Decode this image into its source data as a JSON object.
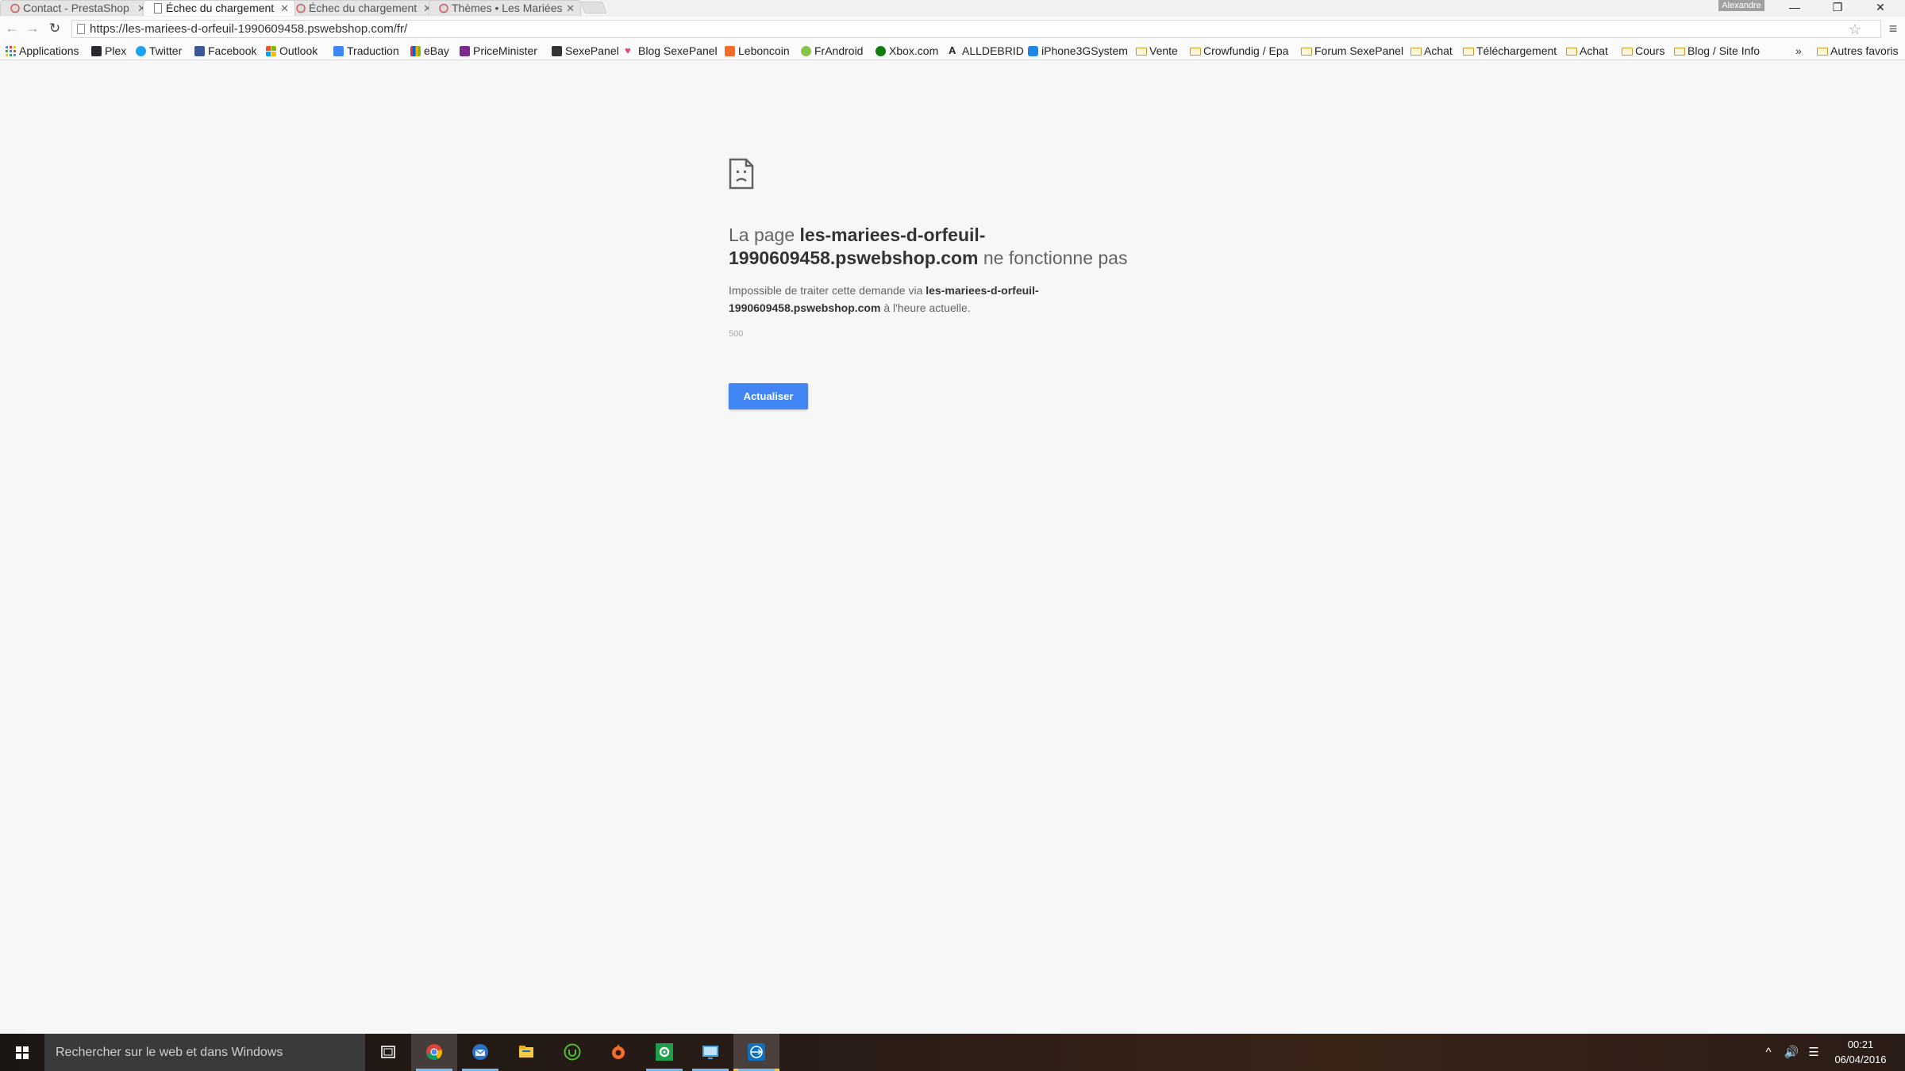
{
  "browser": {
    "tabs": [
      {
        "title": "Contact - PrestaShop"
      },
      {
        "title": "Échec du chargement"
      },
      {
        "title": "Échec du chargement"
      },
      {
        "title": "Thèmes • Les Mariées"
      }
    ],
    "profile_name": "Alexandre",
    "window_controls": {
      "minimize": "—",
      "maximize": "❐",
      "close": "✕"
    },
    "address": "https://les-mariees-d-orfeuil-1990609458.pswebshop.com/fr/",
    "nav": {
      "back": "←",
      "forward": "→",
      "reload": "↻"
    },
    "star": "☆",
    "menu": "≡"
  },
  "bookmarks": {
    "items": [
      {
        "label": "Applications",
        "icon": "apps-grid-icon",
        "color": "#4285f4"
      },
      {
        "label": "Plex",
        "icon": "plex-icon",
        "color": "#282a2d"
      },
      {
        "label": "Twitter",
        "icon": "twitter-icon",
        "color": "#1da1f2"
      },
      {
        "label": "Facebook",
        "icon": "facebook-icon",
        "color": "#3b5998"
      },
      {
        "label": "Outlook",
        "icon": "outlook-icon",
        "color": "#f25022"
      },
      {
        "label": "Traduction",
        "icon": "translate-icon",
        "color": "#4285f4"
      },
      {
        "label": "eBay",
        "icon": "ebay-icon",
        "color": "#e53238"
      },
      {
        "label": "PriceMinister",
        "icon": "priceminister-icon",
        "color": "#7b2a8c"
      },
      {
        "label": "SexePanel",
        "icon": "sexepanel-icon",
        "color": "#333333"
      },
      {
        "label": "Blog SexePanel",
        "icon": "heart-icon",
        "color": "#e0457b"
      },
      {
        "label": "Leboncoin",
        "icon": "leboncoin-icon",
        "color": "#f56b2a"
      },
      {
        "label": "FrAndroid",
        "icon": "frandroid-icon",
        "color": "#8bc34a"
      },
      {
        "label": "Xbox.com",
        "icon": "xbox-icon",
        "color": "#107c10"
      },
      {
        "label": "ALLDEBRID",
        "icon": "alldebrid-icon",
        "color": "#222222"
      },
      {
        "label": "iPhone3GSystem",
        "icon": "iphone-icon",
        "color": "#1e88e5"
      },
      {
        "label": "Vente",
        "icon": "folder-icon"
      },
      {
        "label": "Crowfundig / Epa",
        "icon": "folder-icon"
      },
      {
        "label": "Forum SexePanel",
        "icon": "folder-icon"
      },
      {
        "label": "Achat",
        "icon": "folder-icon"
      },
      {
        "label": "Téléchargement",
        "icon": "folder-icon"
      },
      {
        "label": "Achat",
        "icon": "folder-icon"
      },
      {
        "label": "Cours",
        "icon": "folder-icon"
      },
      {
        "label": "Blog / Site Info",
        "icon": "folder-icon"
      }
    ],
    "overflow": "»",
    "other_bookmarks": "Autres favoris"
  },
  "error_page": {
    "title_prefix": "La page ",
    "title_host": "les-mariees-d-orfeuil-1990609458.pswebshop.com",
    "title_suffix": " ne fonctionne pas",
    "desc_prefix": "Impossible de traiter cette demande via ",
    "desc_host": "les-mariees-d-orfeuil-1990609458.pswebshop.com",
    "desc_suffix": " à l'heure actuelle.",
    "error_code": "500",
    "reload_label": "Actualiser",
    "accent_color": "#4285f4"
  },
  "taskbar": {
    "search_placeholder": "Rechercher sur le web et dans Windows",
    "apps": [
      {
        "name": "task-view-icon"
      },
      {
        "name": "chrome-icon"
      },
      {
        "name": "thunderbird-icon"
      },
      {
        "name": "file-explorer-icon"
      },
      {
        "name": "utorrent-icon"
      },
      {
        "name": "origin-icon"
      },
      {
        "name": "settings-app-icon"
      },
      {
        "name": "remote-desktop-icon"
      },
      {
        "name": "teamviewer-icon"
      }
    ],
    "tray": {
      "up_arrow": "^",
      "volume": "🔊",
      "notifications": "☰"
    },
    "time": "00:21",
    "date": "06/04/2016"
  }
}
